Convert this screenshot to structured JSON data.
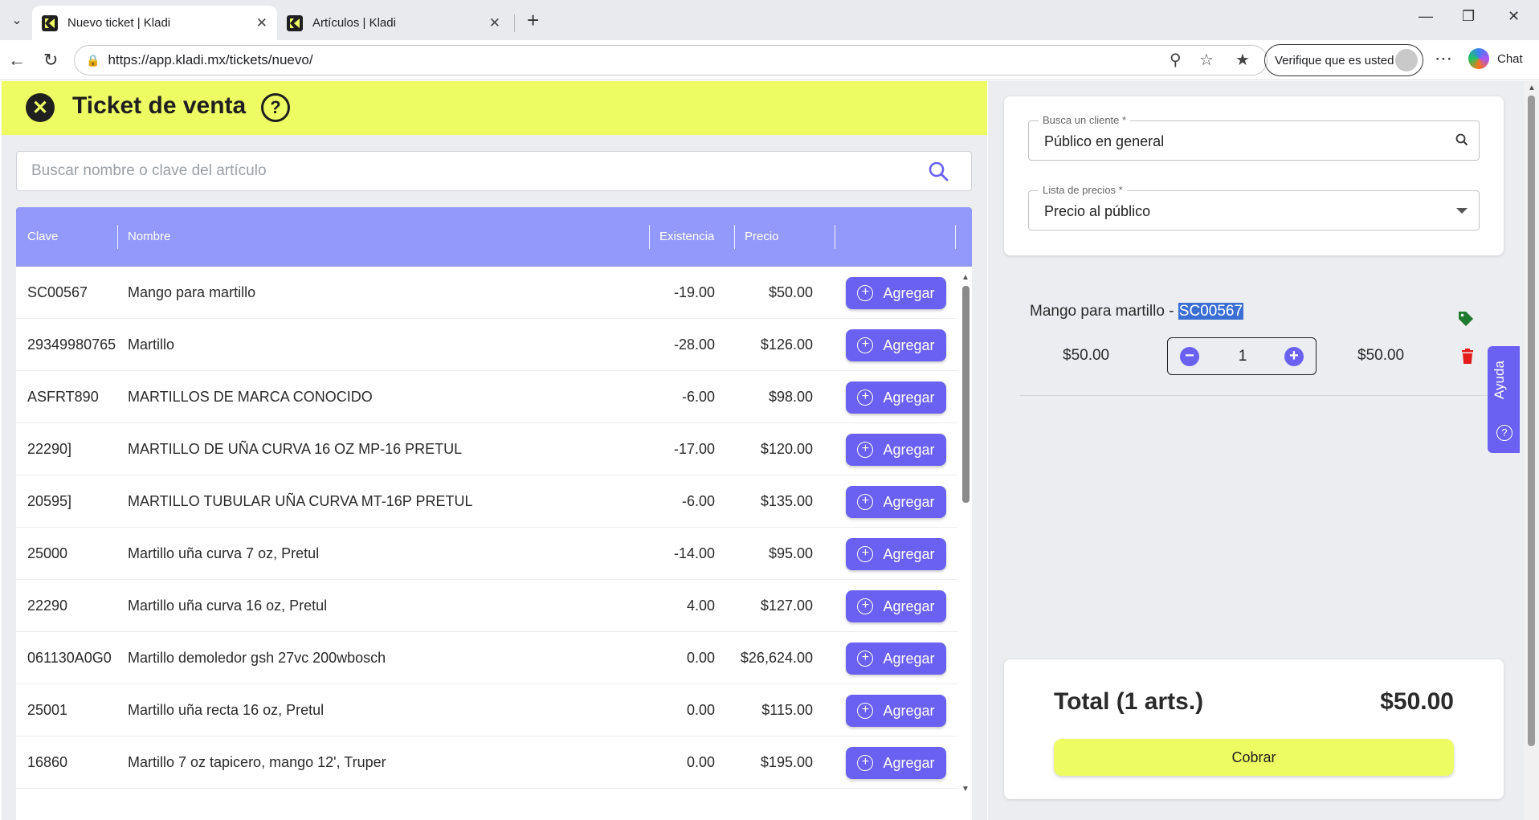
{
  "browser": {
    "tabs": [
      {
        "title": "Nuevo ticket | Kladi",
        "active": true
      },
      {
        "title": "Artículos | Kladi",
        "active": false
      }
    ],
    "url": "https://app.kladi.mx/tickets/nuevo/",
    "verify_label": "Verifique que es usted",
    "chat_label": "Chat"
  },
  "header": {
    "title": "Ticket de venta"
  },
  "search": {
    "placeholder": "Buscar nombre o clave del artículo"
  },
  "table": {
    "columns": [
      "Clave",
      "Nombre",
      "Existencia",
      "Precio"
    ],
    "add_label": "Agregar",
    "rows": [
      {
        "clave": "SC00567",
        "nombre": "Mango para martillo",
        "existencia": "-19.00",
        "precio": "$50.00"
      },
      {
        "clave": "29349980765",
        "nombre": "Martillo",
        "existencia": "-28.00",
        "precio": "$126.00"
      },
      {
        "clave": "ASFRT890",
        "nombre": "MARTILLOS DE MARCA CONOCIDO",
        "existencia": "-6.00",
        "precio": "$98.00"
      },
      {
        "clave": "22290]",
        "nombre": "MARTILLO DE UÑA CURVA 16 OZ MP-16 PRETUL",
        "existencia": "-17.00",
        "precio": "$120.00"
      },
      {
        "clave": "20595]",
        "nombre": "MARTILLO TUBULAR UÑA CURVA MT-16P PRETUL",
        "existencia": "-6.00",
        "precio": "$135.00"
      },
      {
        "clave": "25000",
        "nombre": "Martillo uña curva 7 oz, Pretul",
        "existencia": "-14.00",
        "precio": "$95.00"
      },
      {
        "clave": "22290",
        "nombre": "Martillo uña curva 16 oz, Pretul",
        "existencia": "4.00",
        "precio": "$127.00"
      },
      {
        "clave": "061130A0G0",
        "nombre": "Martillo demoledor gsh 27vc 200wbosch",
        "existencia": "0.00",
        "precio": "$26,624.00"
      },
      {
        "clave": "25001",
        "nombre": "Martillo uña recta 16 oz, Pretul",
        "existencia": "0.00",
        "precio": "$115.00"
      },
      {
        "clave": "16860",
        "nombre": "Martillo 7 oz tapicero, mango 12', Truper",
        "existencia": "0.00",
        "precio": "$195.00"
      }
    ]
  },
  "client": {
    "search_label": "Busca un cliente *",
    "search_value": "Público en general",
    "price_list_label": "Lista de precios *",
    "price_list_value": "Precio al público"
  },
  "cart": {
    "item_name": "Mango para martillo - ",
    "item_code": "SC00567",
    "unit_price": "$50.00",
    "quantity": "1",
    "line_total": "$50.00"
  },
  "help_tab": {
    "label": "Ayuda"
  },
  "totals": {
    "label": "Total (1 arts.)",
    "amount": "$50.00",
    "charge_label": "Cobrar"
  },
  "colors": {
    "accent": "#6a61f2",
    "table_header": "#9399fb",
    "brand_yellow": "#eefc63",
    "tag_green": "#1f7a2e",
    "delete_red": "#e31b1b"
  },
  "icons": [
    "menu-icon",
    "kladi-favicon",
    "close-icon",
    "new-tab-icon",
    "back-icon",
    "reload-icon",
    "lock-icon",
    "key-icon",
    "star-icon",
    "favorites-icon",
    "search-icon",
    "help-icon",
    "tag-icon",
    "trash-icon",
    "plus-circle-icon",
    "minus-circle-icon"
  ]
}
